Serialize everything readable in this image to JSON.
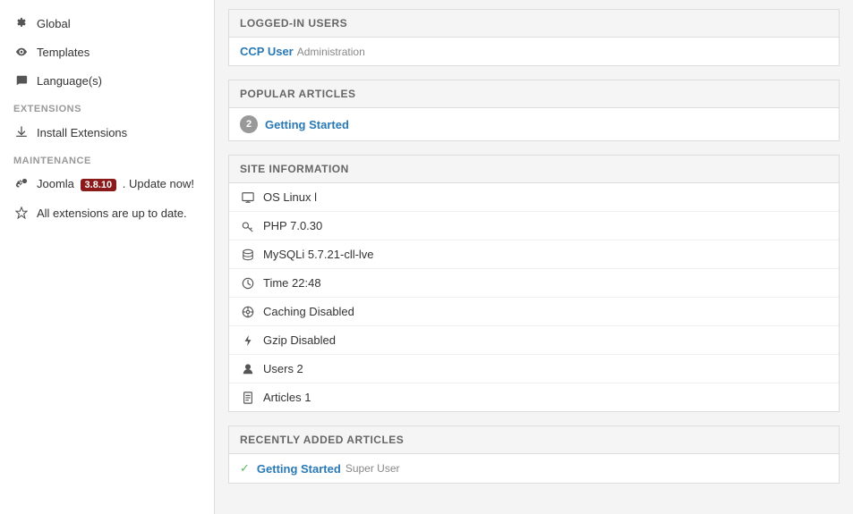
{
  "sidebar": {
    "items": [
      {
        "id": "global",
        "label": "Global",
        "icon": "gear"
      },
      {
        "id": "templates",
        "label": "Templates",
        "icon": "eye"
      },
      {
        "id": "languages",
        "label": "Language(s)",
        "icon": "comment"
      }
    ],
    "extensions_section": "EXTENSIONS",
    "extensions_items": [
      {
        "id": "install-extensions",
        "label": "Install Extensions",
        "icon": "download"
      }
    ],
    "maintenance_section": "MAINTENANCE",
    "maintenance_items": [
      {
        "id": "joomla-update",
        "joomla_label": "Joomla",
        "badge": "3.8.10",
        "update_text": ". Update now!",
        "icon": "joomla"
      },
      {
        "id": "extensions-uptodate",
        "label": "All extensions are up to date.",
        "icon": "star"
      }
    ]
  },
  "logged_in_users": {
    "header": "LOGGED-IN USERS",
    "users": [
      {
        "name": "CCP User",
        "role": "Administration"
      }
    ]
  },
  "popular_articles": {
    "header": "POPULAR ARTICLES",
    "articles": [
      {
        "count": 2,
        "title": "Getting Started"
      }
    ]
  },
  "site_information": {
    "header": "SITE INFORMATION",
    "items": [
      {
        "icon": "monitor",
        "label": "OS Linux l"
      },
      {
        "icon": "key",
        "label": "PHP 7.0.30"
      },
      {
        "icon": "database",
        "label": "MySQLi 5.7.21-cll-lve"
      },
      {
        "icon": "clock",
        "label": "Time 22:48"
      },
      {
        "icon": "circle-o",
        "label": "Caching Disabled"
      },
      {
        "icon": "bolt",
        "label": "Gzip Disabled"
      },
      {
        "icon": "user",
        "label": "Users 2"
      },
      {
        "icon": "file",
        "label": "Articles 1"
      }
    ]
  },
  "recently_added": {
    "header": "RECENTLY ADDED ARTICLES",
    "articles": [
      {
        "title": "Getting Started",
        "author": "Super User"
      }
    ]
  }
}
